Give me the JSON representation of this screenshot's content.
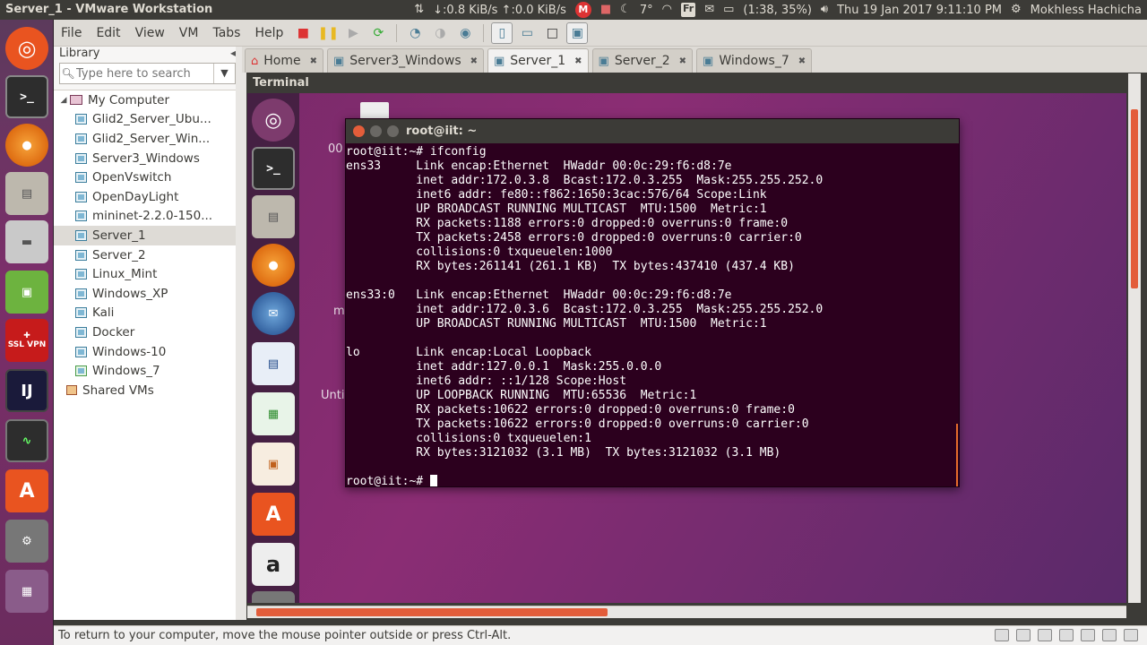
{
  "panel": {
    "window_title": "Server_1 - VMware Workstation",
    "net_speed": "↓:0.8 KiB/s ↑:0.0 KiB/s",
    "temperature": "7°",
    "keyboard_layout": "Fr",
    "battery": "(1:38, 35%)",
    "datetime": "Thu 19 Jan 2017 9:11:10 PM",
    "user": "Mokhless Hachicha",
    "mail_badge": "M"
  },
  "menu": [
    "File",
    "Edit",
    "View",
    "VM",
    "Tabs",
    "Help"
  ],
  "library": {
    "title": "Library",
    "search_placeholder": "Type here to search",
    "root": "My Computer",
    "items": [
      "Glid2_Server_Ubu...",
      "Glid2_Server_Win...",
      "Server3_Windows",
      "OpenVswitch",
      "OpenDayLight",
      "mininet-2.2.0-150...",
      "Server_1",
      "Server_2",
      "Linux_Mint",
      "Windows_XP",
      "Kali",
      "Docker",
      "Windows-10",
      "Windows_7"
    ],
    "selected": "Server_1",
    "shared": "Shared VMs"
  },
  "tabs": [
    {
      "label": "Home",
      "active": false
    },
    {
      "label": "Server3_Windows",
      "active": false
    },
    {
      "label": "Server_1",
      "active": true
    },
    {
      "label": "Server_2",
      "active": false
    },
    {
      "label": "Windows_7",
      "active": false
    }
  ],
  "guest": {
    "top_title": "Terminal",
    "desktop_labels": [
      "00",
      "m",
      "Unti"
    ],
    "launcher_labels": {
      "amazon": "a"
    }
  },
  "terminal": {
    "title": "root@iit: ~",
    "lines": [
      "root@iit:~# ifconfig",
      "ens33     Link encap:Ethernet  HWaddr 00:0c:29:f6:d8:7e",
      "          inet addr:172.0.3.8  Bcast:172.0.3.255  Mask:255.255.252.0",
      "          inet6 addr: fe80::f862:1650:3cac:576/64 Scope:Link",
      "          UP BROADCAST RUNNING MULTICAST  MTU:1500  Metric:1",
      "          RX packets:1188 errors:0 dropped:0 overruns:0 frame:0",
      "          TX packets:2458 errors:0 dropped:0 overruns:0 carrier:0",
      "          collisions:0 txqueuelen:1000",
      "          RX bytes:261141 (261.1 KB)  TX bytes:437410 (437.4 KB)",
      "",
      "ens33:0   Link encap:Ethernet  HWaddr 00:0c:29:f6:d8:7e",
      "          inet addr:172.0.3.6  Bcast:172.0.3.255  Mask:255.255.252.0",
      "          UP BROADCAST RUNNING MULTICAST  MTU:1500  Metric:1",
      "",
      "lo        Link encap:Local Loopback",
      "          inet addr:127.0.0.1  Mask:255.0.0.0",
      "          inet6 addr: ::1/128 Scope:Host",
      "          UP LOOPBACK RUNNING  MTU:65536  Metric:1",
      "          RX packets:10622 errors:0 dropped:0 overruns:0 frame:0",
      "          TX packets:10622 errors:0 dropped:0 overruns:0 carrier:0",
      "          collisions:0 txqueuelen:1",
      "          RX bytes:3121032 (3.1 MB)  TX bytes:3121032 (3.1 MB)",
      ""
    ],
    "prompt": "root@iit:~# "
  },
  "launcher": {
    "ssl_vpn_label": "SSL VPN",
    "intellij_label": "IJ"
  },
  "status": {
    "message": "To return to your computer, move the mouse pointer outside or press Ctrl-Alt."
  },
  "colors": {
    "terminal_bg": "#2c001e",
    "panel_bg": "#3c3b37",
    "accent": "#e35d3a"
  }
}
